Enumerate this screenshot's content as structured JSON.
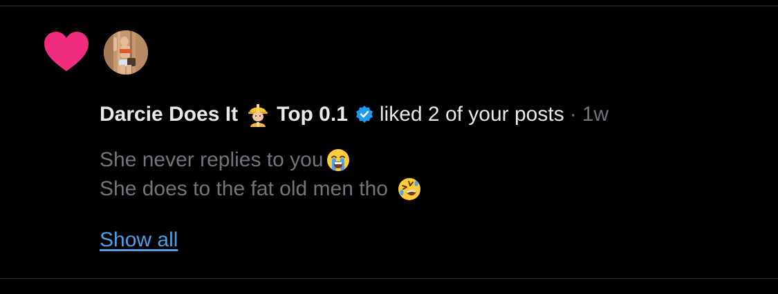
{
  "notification": {
    "type_icon": "heart-icon",
    "type_icon_color": "#f02c7f",
    "avatar_icon": "avatar",
    "user_name": "Darcie Does It",
    "name_emoji": "construction-worker-emoji",
    "name_suffix": "Top 0.1",
    "verified_icon": "verified-badge-icon",
    "verified_color": "#1d9bf0",
    "action_text": "liked 2 of your posts",
    "separator": "·",
    "time_ago": "1w",
    "post_lines": [
      "She never replies to you",
      "She does to the fat old men tho"
    ],
    "post_line_emojis": [
      "loudly-crying-face-emoji",
      "rolling-on-the-floor-laughing-emoji"
    ],
    "show_all_label": "Show all",
    "link_color": "#4e9fe8"
  }
}
